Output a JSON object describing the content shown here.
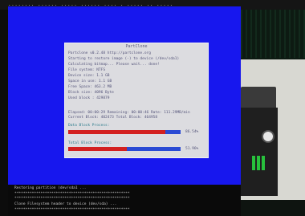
{
  "top_bar": {
    "text": "........ ...... ..... ...... .... . ..... .. ....."
  },
  "panel": {
    "title": "PartClone",
    "lines": [
      "Partclone v0.2.48 http://partclone.org",
      "Starting to restore image (-) to device (/dev/sda1)",
      "Calculating bitmap... Please wait... done!",
      "File system:  NTFS",
      "Device size:    1.1 GB",
      "Space in use:   1.1 GB",
      "Free Space:   463.2 MB",
      "Block size:   4096 Byte",
      "Used block :  429879"
    ],
    "status_lines": [
      "Elapsed: 00:00:29  Remaining: 00:00:46  Rate: 111.29MB/min",
      "Current Block: 402473  Total Block: 464958"
    ],
    "data_progress": {
      "label": "Data Block Process:",
      "value": 0.865,
      "percent": "86.54%"
    },
    "total_progress": {
      "label": "Total Block Process:",
      "value": 0.52,
      "percent": "51.96%"
    }
  },
  "terminal": {
    "lines": [
      "Restoring partition (dev/sda1 ...",
      "*****************************************************",
      "*****************************************************",
      "Clone Filesystem header to device (dev/sda) ...",
      "*****************************************************"
    ]
  },
  "colors": {
    "screen_blue": "#1717ee",
    "panel_bg": "#dcdce0",
    "bar_blue": "#2a4ad4",
    "bar_red": "#d32020"
  }
}
